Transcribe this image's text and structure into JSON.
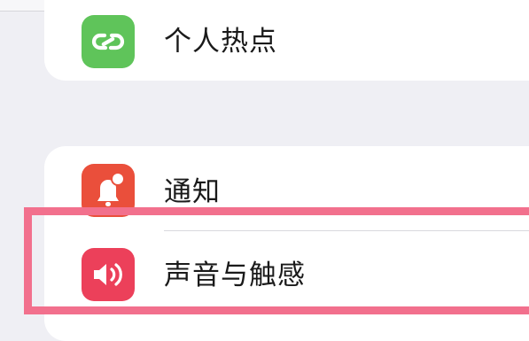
{
  "settings": {
    "hotspot": {
      "label": "个人热点",
      "icon": "personal-hotspot-icon",
      "icon_color": "#5fc45a"
    },
    "notifications": {
      "label": "通知",
      "icon": "notification-bell-icon",
      "icon_color": "#ea4f3b"
    },
    "sounds": {
      "label": "声音与触感",
      "icon": "speaker-sound-icon",
      "icon_color": "#ec405a"
    }
  },
  "colors": {
    "background": "#efeff4",
    "card": "#ffffff",
    "highlight": "#f2708d"
  }
}
